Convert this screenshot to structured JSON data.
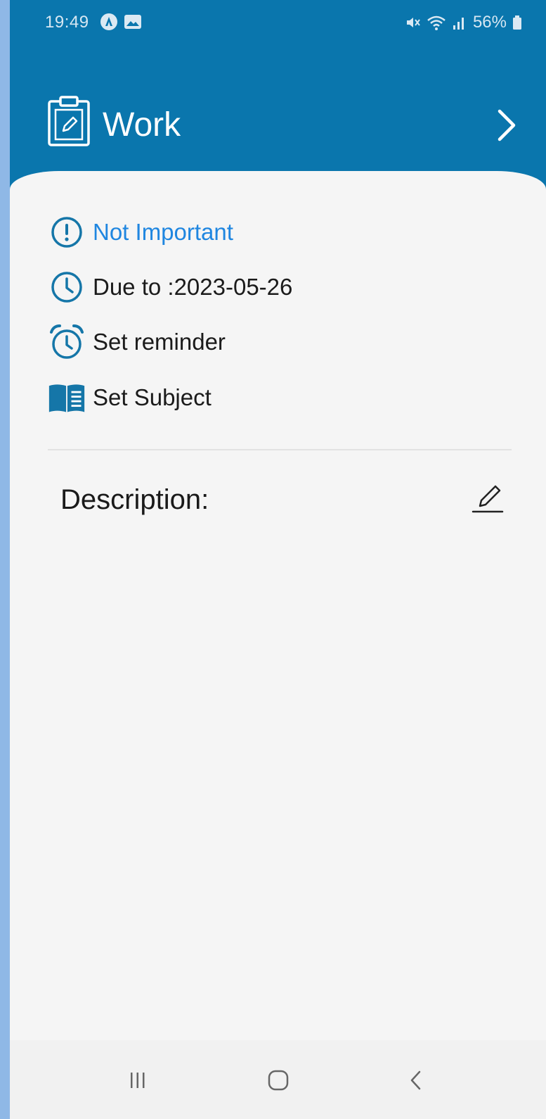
{
  "status_bar": {
    "time": "19:49",
    "battery": "56%",
    "icons": [
      "app-notification-icon",
      "image-notification-icon",
      "mute-icon",
      "wifi-icon",
      "signal-icon",
      "battery-icon"
    ]
  },
  "header": {
    "title": "Work",
    "icon": "clipboard-edit-icon",
    "next_icon": "chevron-right-icon"
  },
  "details": {
    "importance": "Not Important",
    "due": "Due to :2023-05-26",
    "reminder": "Set reminder",
    "subject": "Set Subject"
  },
  "description": {
    "label": "Description:",
    "edit_icon": "pencil-icon"
  },
  "colors": {
    "header_bg": "#0a76ad",
    "accent_blue": "#1f86e0",
    "icon_teal": "#1576a8",
    "card_bg": "#f5f5f5",
    "outer_bg": "#8fb8e6"
  },
  "navbar": {
    "icons": [
      "recent-apps-icon",
      "home-icon",
      "back-icon"
    ]
  }
}
